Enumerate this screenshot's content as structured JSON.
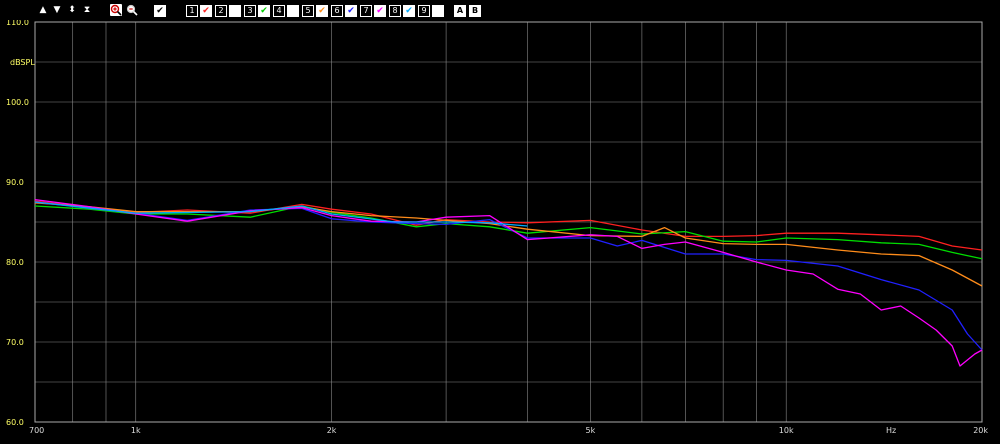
{
  "toolbar": {
    "arrows": [
      "▲",
      "▼",
      "⬍",
      "⧗"
    ],
    "zoom_in_icon": "zoom-in-icon",
    "zoom_out_icon": "zoom-out-icon",
    "check_all": "✔",
    "channels": [
      {
        "num": "1",
        "checked": true,
        "color": "#ff2020"
      },
      {
        "num": "2",
        "checked": false,
        "color": "#ffffff"
      },
      {
        "num": "3",
        "checked": true,
        "color": "#00cc00"
      },
      {
        "num": "4",
        "checked": false,
        "color": "#ffffff"
      },
      {
        "num": "5",
        "checked": true,
        "color": "#ff8c1a"
      },
      {
        "num": "6",
        "checked": true,
        "color": "#2020ff"
      },
      {
        "num": "7",
        "checked": true,
        "color": "#ff00ff"
      },
      {
        "num": "8",
        "checked": true,
        "color": "#00aaff"
      },
      {
        "num": "9",
        "checked": false,
        "color": "#ffffff"
      }
    ],
    "a_label": "A",
    "b_label": "B"
  },
  "chart_data": {
    "type": "line",
    "ylabel": "dBSPL",
    "xlabel": "Hz",
    "x_scale": "log",
    "xlim": [
      700,
      20000
    ],
    "ylim": [
      60,
      110
    ],
    "x_ticks": [
      {
        "v": 700,
        "label": "700"
      },
      {
        "v": 1000,
        "label": "1k"
      },
      {
        "v": 2000,
        "label": "2k"
      },
      {
        "v": 5000,
        "label": "5k"
      },
      {
        "v": 10000,
        "label": "10k"
      },
      {
        "v": 20000,
        "label": "20k"
      }
    ],
    "y_ticks": [
      {
        "v": 110,
        "label": "110.0"
      },
      {
        "v": 100,
        "label": "100.0"
      },
      {
        "v": 90,
        "label": "90.0"
      },
      {
        "v": 80,
        "label": "80.0"
      },
      {
        "v": 70,
        "label": "70.0"
      },
      {
        "v": 60,
        "label": "60.0"
      }
    ],
    "grid": true,
    "series": [
      {
        "color": "#ff2020",
        "points": [
          [
            700,
            87.6
          ],
          [
            850,
            86.8
          ],
          [
            1000,
            86.2
          ],
          [
            1200,
            86.5
          ],
          [
            1500,
            86.1
          ],
          [
            1800,
            87.2
          ],
          [
            2000,
            86.6
          ],
          [
            2300,
            86.0
          ],
          [
            2700,
            84.6
          ],
          [
            3000,
            85.3
          ],
          [
            3500,
            85.0
          ],
          [
            4000,
            84.9
          ],
          [
            5000,
            85.2
          ],
          [
            6000,
            84.0
          ],
          [
            7000,
            83.2
          ],
          [
            8000,
            83.2
          ],
          [
            9000,
            83.3
          ],
          [
            10000,
            83.6
          ],
          [
            12000,
            83.6
          ],
          [
            14000,
            83.4
          ],
          [
            16000,
            83.2
          ],
          [
            18000,
            82.0
          ],
          [
            20000,
            81.5
          ]
        ]
      },
      {
        "color": "#00dd00",
        "points": [
          [
            700,
            87.0
          ],
          [
            850,
            86.6
          ],
          [
            1000,
            86.0
          ],
          [
            1200,
            86.0
          ],
          [
            1500,
            85.6
          ],
          [
            1800,
            87.0
          ],
          [
            2000,
            86.2
          ],
          [
            2300,
            85.5
          ],
          [
            2700,
            84.4
          ],
          [
            3000,
            84.8
          ],
          [
            3500,
            84.4
          ],
          [
            4000,
            83.6
          ],
          [
            5000,
            84.3
          ],
          [
            6000,
            83.5
          ],
          [
            7000,
            83.8
          ],
          [
            8000,
            82.6
          ],
          [
            9000,
            82.5
          ],
          [
            10000,
            83.0
          ],
          [
            12000,
            82.8
          ],
          [
            14000,
            82.4
          ],
          [
            16000,
            82.2
          ],
          [
            18000,
            81.2
          ],
          [
            20000,
            80.4
          ]
        ]
      },
      {
        "color": "#ff8c1a",
        "points": [
          [
            700,
            87.4
          ],
          [
            850,
            86.9
          ],
          [
            1000,
            86.3
          ],
          [
            1200,
            86.3
          ],
          [
            1500,
            86.3
          ],
          [
            1800,
            86.9
          ],
          [
            2000,
            86.3
          ],
          [
            2300,
            85.8
          ],
          [
            2700,
            85.5
          ],
          [
            3000,
            85.2
          ],
          [
            3500,
            84.8
          ],
          [
            4000,
            84.1
          ],
          [
            5000,
            83.3
          ],
          [
            6000,
            83.2
          ],
          [
            6500,
            84.3
          ],
          [
            7000,
            83.0
          ],
          [
            8000,
            82.3
          ],
          [
            9000,
            82.2
          ],
          [
            10000,
            82.2
          ],
          [
            12000,
            81.5
          ],
          [
            14000,
            81.0
          ],
          [
            16000,
            80.8
          ],
          [
            18000,
            79.0
          ],
          [
            20000,
            77.0
          ]
        ]
      },
      {
        "color": "#2020ff",
        "points": [
          [
            700,
            87.5
          ],
          [
            850,
            86.7
          ],
          [
            1000,
            86.1
          ],
          [
            1200,
            85.2
          ],
          [
            1500,
            86.5
          ],
          [
            1800,
            86.7
          ],
          [
            2000,
            85.4
          ],
          [
            2300,
            85.0
          ],
          [
            2700,
            84.8
          ],
          [
            3000,
            84.7
          ],
          [
            3500,
            85.3
          ],
          [
            4000,
            83.0
          ],
          [
            5000,
            83.0
          ],
          [
            5500,
            82.0
          ],
          [
            6000,
            82.7
          ],
          [
            7000,
            81.0
          ],
          [
            8000,
            81.0
          ],
          [
            9000,
            80.3
          ],
          [
            10000,
            80.2
          ],
          [
            12000,
            79.5
          ],
          [
            14000,
            77.8
          ],
          [
            16000,
            76.5
          ],
          [
            18000,
            74.0
          ],
          [
            19000,
            71.0
          ],
          [
            20000,
            69.0
          ]
        ]
      },
      {
        "color": "#ff00ff",
        "points": [
          [
            700,
            87.8
          ],
          [
            850,
            86.9
          ],
          [
            1000,
            86.0
          ],
          [
            1200,
            85.1
          ],
          [
            1500,
            86.4
          ],
          [
            1800,
            86.8
          ],
          [
            2000,
            85.8
          ],
          [
            2300,
            85.1
          ],
          [
            2700,
            85.0
          ],
          [
            3000,
            85.6
          ],
          [
            3500,
            85.8
          ],
          [
            4000,
            82.8
          ],
          [
            5000,
            83.4
          ],
          [
            5500,
            83.2
          ],
          [
            6000,
            81.7
          ],
          [
            6500,
            82.2
          ],
          [
            7000,
            82.5
          ],
          [
            8000,
            81.2
          ],
          [
            9000,
            80.0
          ],
          [
            10000,
            79.0
          ],
          [
            11000,
            78.5
          ],
          [
            12000,
            76.6
          ],
          [
            13000,
            76.0
          ],
          [
            14000,
            74.0
          ],
          [
            15000,
            74.5
          ],
          [
            16000,
            73.0
          ],
          [
            17000,
            71.5
          ],
          [
            18000,
            69.5
          ],
          [
            18500,
            67.0
          ],
          [
            19500,
            68.5
          ],
          [
            20000,
            69.0
          ]
        ]
      },
      {
        "color": "#00aaff",
        "points": [
          [
            700,
            87.5
          ],
          [
            1000,
            86.1
          ],
          [
            1500,
            86.3
          ],
          [
            1800,
            87.0
          ],
          [
            2000,
            86.0
          ],
          [
            2500,
            85.0
          ],
          [
            3000,
            85.0
          ],
          [
            3500,
            84.9
          ],
          [
            4000,
            84.5
          ]
        ]
      }
    ]
  }
}
